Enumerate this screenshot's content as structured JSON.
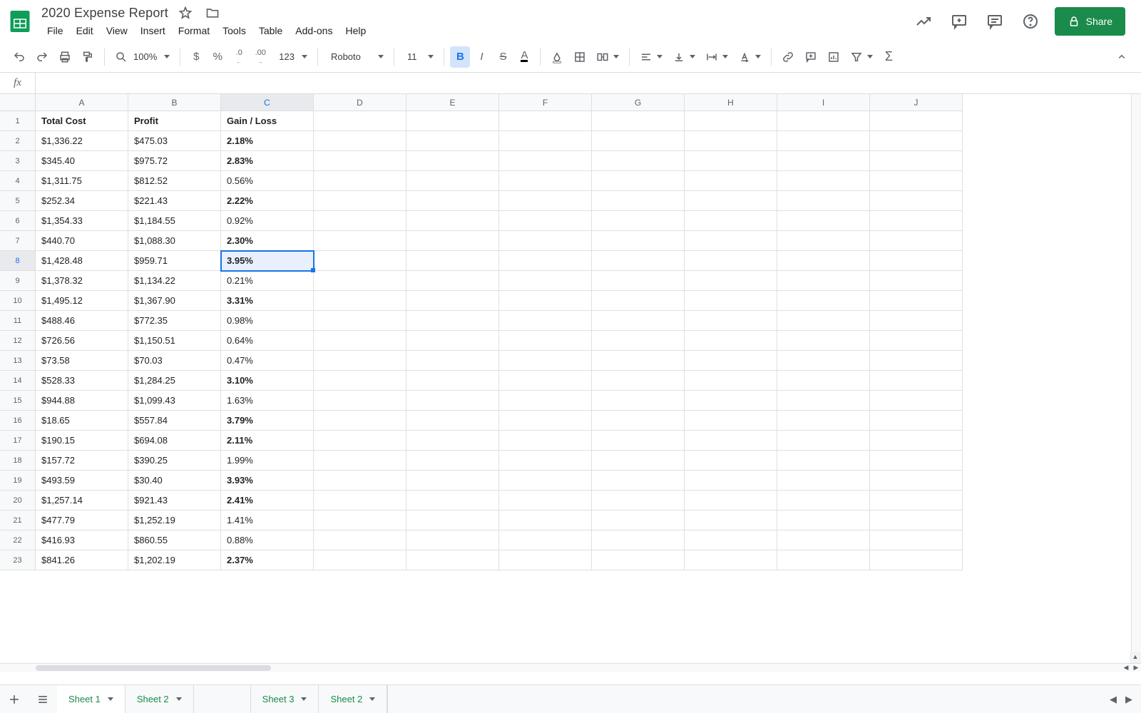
{
  "doc": {
    "title": "2020 Expense Report"
  },
  "menus": [
    "File",
    "Edit",
    "View",
    "Insert",
    "Format",
    "Tools",
    "Table",
    "Add-ons",
    "Help"
  ],
  "toolbar": {
    "zoom": "100%",
    "number_format": "123",
    "font": "Roboto",
    "font_size": "11"
  },
  "share_label": "Share",
  "columns": [
    "A",
    "B",
    "C",
    "D",
    "E",
    "F",
    "G",
    "H",
    "I",
    "J"
  ],
  "headers": [
    "Total Cost",
    "Profit",
    "Gain / Loss"
  ],
  "rows": [
    {
      "a": "$1,336.22",
      "b": "$475.03",
      "c": "2.18%",
      "bold": true
    },
    {
      "a": "$345.40",
      "b": "$975.72",
      "c": "2.83%",
      "bold": true
    },
    {
      "a": "$1,311.75",
      "b": "$812.52",
      "c": "0.56%",
      "bold": false
    },
    {
      "a": "$252.34",
      "b": "$221.43",
      "c": "2.22%",
      "bold": true
    },
    {
      "a": "$1,354.33",
      "b": "$1,184.55",
      "c": "0.92%",
      "bold": false
    },
    {
      "a": "$440.70",
      "b": "$1,088.30",
      "c": "2.30%",
      "bold": true
    },
    {
      "a": "$1,428.48",
      "b": "$959.71",
      "c": "3.95%",
      "bold": true
    },
    {
      "a": "$1,378.32",
      "b": "$1,134.22",
      "c": "0.21%",
      "bold": false
    },
    {
      "a": "$1,495.12",
      "b": "$1,367.90",
      "c": "3.31%",
      "bold": true
    },
    {
      "a": "$488.46",
      "b": "$772.35",
      "c": "0.98%",
      "bold": false
    },
    {
      "a": "$726.56",
      "b": "$1,150.51",
      "c": "0.64%",
      "bold": false
    },
    {
      "a": "$73.58",
      "b": "$70.03",
      "c": "0.47%",
      "bold": false
    },
    {
      "a": "$528.33",
      "b": "$1,284.25",
      "c": "3.10%",
      "bold": true
    },
    {
      "a": "$944.88",
      "b": "$1,099.43",
      "c": "1.63%",
      "bold": false
    },
    {
      "a": "$18.65",
      "b": "$557.84",
      "c": "3.79%",
      "bold": true
    },
    {
      "a": "$190.15",
      "b": "$694.08",
      "c": "2.11%",
      "bold": true
    },
    {
      "a": "$157.72",
      "b": "$390.25",
      "c": "1.99%",
      "bold": false
    },
    {
      "a": "$493.59",
      "b": "$30.40",
      "c": "3.93%",
      "bold": true
    },
    {
      "a": "$1,257.14",
      "b": "$921.43",
      "c": "2.41%",
      "bold": true
    },
    {
      "a": "$477.79",
      "b": "$1,252.19",
      "c": "1.41%",
      "bold": false
    },
    {
      "a": "$416.93",
      "b": "$860.55",
      "c": "0.88%",
      "bold": false
    },
    {
      "a": "$841.26",
      "b": "$1,202.19",
      "c": "2.37%",
      "bold": true
    }
  ],
  "selected": {
    "row": 8,
    "col": "C"
  },
  "tabs": [
    {
      "name": "Sheet 1",
      "active": true
    },
    {
      "name": "Sheet 2",
      "active": false
    },
    {
      "name": "Sheet 3",
      "active": false
    },
    {
      "name": "Sheet 2",
      "active": false
    }
  ]
}
